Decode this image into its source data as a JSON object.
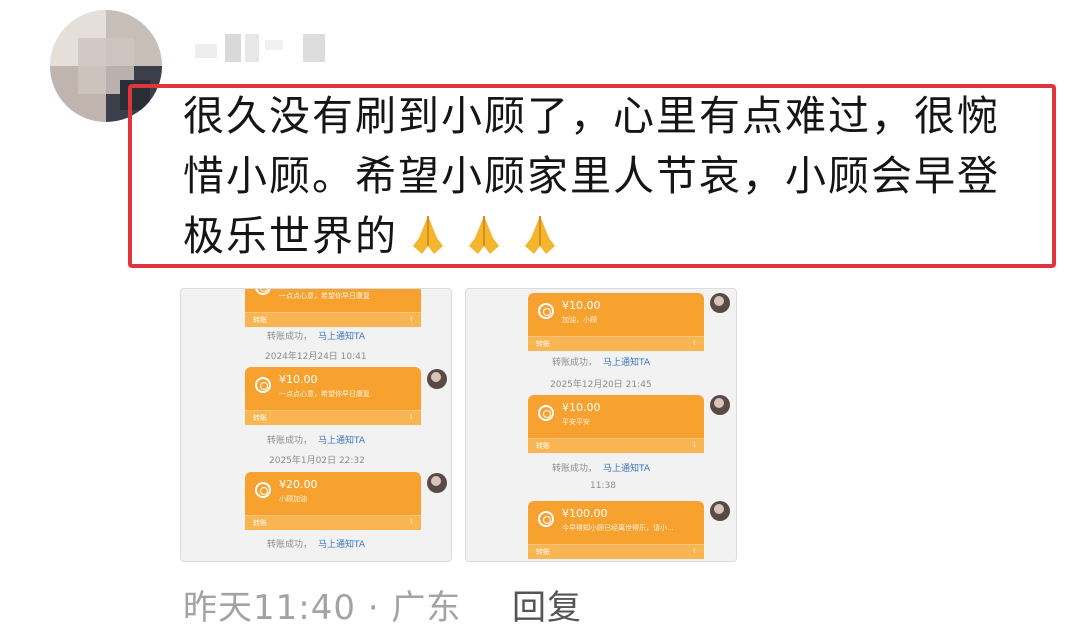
{
  "comment": {
    "text": "很久没有刷到小顾了，心里有点难过，很惋惜小顾。希望小顾家里人节哀，小顾会早登极乐世界的",
    "emoji_count": 3
  },
  "shot1": {
    "top_memo": "一点点心意，希望你早日康复",
    "top_foot_label": "转账",
    "sys1": "转账成功，",
    "sys1_link": "马上通知TA",
    "time1": "2024年12月24日 10:41",
    "card1_amount": "¥10.00",
    "card1_memo": "一点点心意，希望你早日康复",
    "card1_foot": "转账",
    "sys2": "转账成功，",
    "sys2_link": "马上通知TA",
    "time2": "2025年1月02日 22:32",
    "card2_amount": "¥20.00",
    "card2_memo": "小顾加油",
    "card2_foot": "转账",
    "sys3": "转账成功，",
    "sys3_link": "马上通知TA"
  },
  "shot2": {
    "card0_amount": "¥10.00",
    "card0_memo": "加油，小顾",
    "card0_foot": "转账",
    "sys1": "转账成功，",
    "sys1_link": "马上通知TA",
    "time1": "2025年12月20日 21:45",
    "card1_amount": "¥10.00",
    "card1_memo": "平安平安",
    "card1_foot": "转账",
    "sys2": "转账成功，",
    "sys2_link": "马上通知TA",
    "time2": "11:38",
    "card2_amount": "¥100.00",
    "card2_memo": "今早得知小顾已经离世得乐，请小...",
    "card2_foot": "转账"
  },
  "footer": {
    "meta": "昨天11:40 · 广东",
    "reply": "回复"
  },
  "colors": {
    "highlight_border": "#e2343b",
    "card": "#f7a12f",
    "link": "#3b76c4"
  }
}
